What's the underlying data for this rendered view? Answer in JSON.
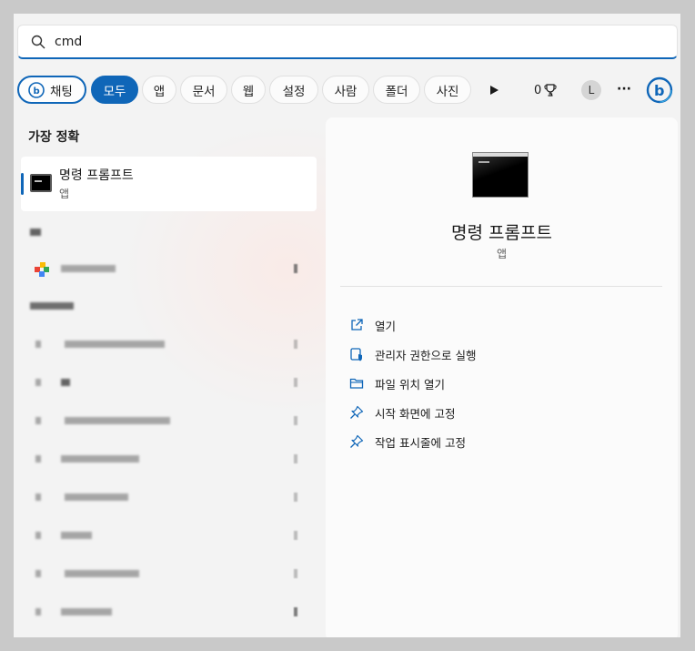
{
  "search": {
    "value": "cmd"
  },
  "filters": {
    "chat_label": "채팅",
    "tabs": [
      "모두",
      "앱",
      "문서",
      "웹",
      "설정",
      "사람",
      "폴더",
      "사진"
    ],
    "points": "0",
    "avatar_initial": "L",
    "more": "···"
  },
  "left": {
    "section_title": "가장 정확",
    "best_match": {
      "name": "명령 프롬프트",
      "kind": "앱"
    }
  },
  "detail": {
    "title": "명령 프롬프트",
    "subtitle": "앱",
    "actions": [
      {
        "label": "열기",
        "icon": "open-external-icon"
      },
      {
        "label": "관리자 권한으로 실행",
        "icon": "shield-admin-icon"
      },
      {
        "label": "파일 위치 열기",
        "icon": "folder-icon"
      },
      {
        "label": "시작 화면에 고정",
        "icon": "pin-icon"
      },
      {
        "label": "작업 표시줄에 고정",
        "icon": "pin-icon"
      }
    ]
  },
  "colors": {
    "accent": "#0f66b8",
    "panel": "#f3f3f3",
    "detail": "#fbfbfb"
  }
}
